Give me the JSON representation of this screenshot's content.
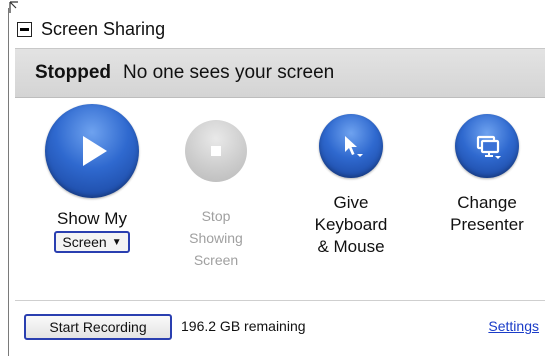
{
  "panel": {
    "title": "Screen Sharing",
    "collapse_icon": "minus-box-icon"
  },
  "status": {
    "state": "Stopped",
    "message": "No one sees your screen"
  },
  "controls": {
    "show": {
      "icon": "play-icon",
      "label": "Show My",
      "select_value": "Screen",
      "enabled": true
    },
    "stop": {
      "icon": "stop-icon",
      "label_lines": [
        "Stop",
        "Showing",
        "Screen"
      ],
      "enabled": false
    },
    "give": {
      "icon": "cursor-dropdown-icon",
      "label_lines": [
        "Give",
        "Keyboard",
        "& Mouse"
      ],
      "enabled": true
    },
    "change": {
      "icon": "presenter-monitor-icon",
      "label_lines": [
        "Change",
        "Presenter"
      ],
      "enabled": true
    }
  },
  "footer": {
    "record_label": "Start Recording",
    "remaining": "196.2 GB remaining",
    "settings_label": "Settings"
  },
  "colors": {
    "accent_blue": "#2f69cf",
    "button_border": "#2a3fb0",
    "link": "#1a3cc8",
    "disabled": "#a0a0a0",
    "status_bar": "#d9d9d9"
  }
}
